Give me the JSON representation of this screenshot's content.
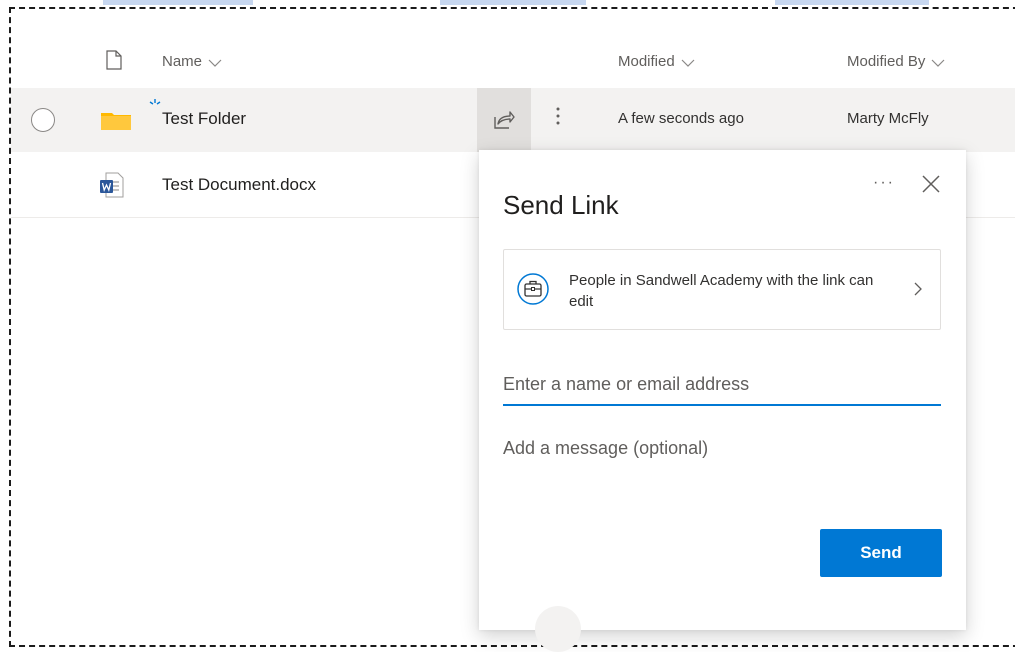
{
  "header": {
    "name_label": "Name",
    "modified_label": "Modified",
    "modified_by_label": "Modified By"
  },
  "files": [
    {
      "name": "Test Folder",
      "modified": "A few seconds ago",
      "modified_by": "Marty McFly",
      "type": "folder"
    },
    {
      "name": "Test Document.docx",
      "modified": "",
      "modified_by": "",
      "type": "word-document"
    }
  ],
  "send_link": {
    "title": "Send Link",
    "permission_text": "People in Sandwell Academy with the link can edit",
    "email_placeholder": "Enter a name or email address",
    "message_placeholder": "Add a message (optional)",
    "send_label": "Send",
    "more_label": "···"
  },
  "colors": {
    "accent": "#0078d4",
    "folder": "#ffb900",
    "word": "#2b579a",
    "selected_row": "#f3f2f1"
  }
}
